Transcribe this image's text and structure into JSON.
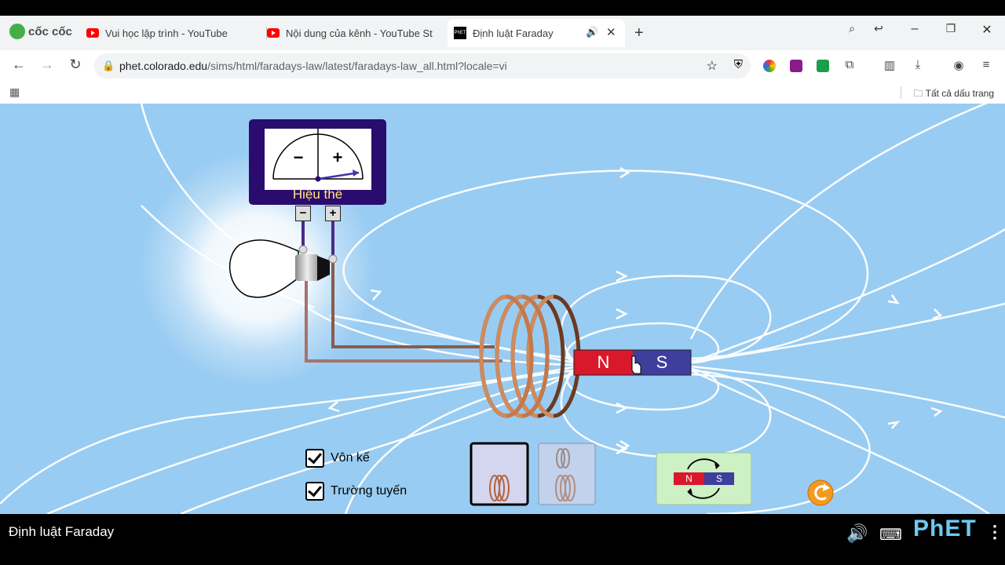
{
  "browser": {
    "brand": "cốc cốc",
    "tabs": [
      {
        "label": "Vui học lập trình - YouTube",
        "icon": "youtube-icon"
      },
      {
        "label": "Nội dung của kênh - YouTube St",
        "icon": "youtube-icon"
      },
      {
        "label": "Định luật Faraday",
        "icon": "phet-icon",
        "active": true
      }
    ],
    "url_host": "phet.colorado.edu",
    "url_path": "/sims/html/faradays-law/latest/faradays-law_all.html?locale=vi",
    "bookmarks_all": "Tất cả dấu trang"
  },
  "sim": {
    "meter_label": "Hiệu thế",
    "meter_minus": "−",
    "meter_plus": "+",
    "terminal_minus": "−",
    "terminal_plus": "+",
    "magnet_n": "N",
    "magnet_s": "S",
    "checkbox_voltmeter": "Vôn kế",
    "checkbox_field_lines": "Trường tuyến",
    "flip_n": "N",
    "flip_s": "S",
    "voltmeter_checked": true,
    "field_lines_checked": true,
    "colors": {
      "background": "#99ccf2",
      "magnet_north": "#d9182b",
      "magnet_south": "#3e3e9c",
      "coil": "#b35c2e",
      "meter_frame": "#2a0b6e"
    }
  },
  "footer": {
    "title": "Định luật Faraday",
    "brand": "PhET"
  }
}
